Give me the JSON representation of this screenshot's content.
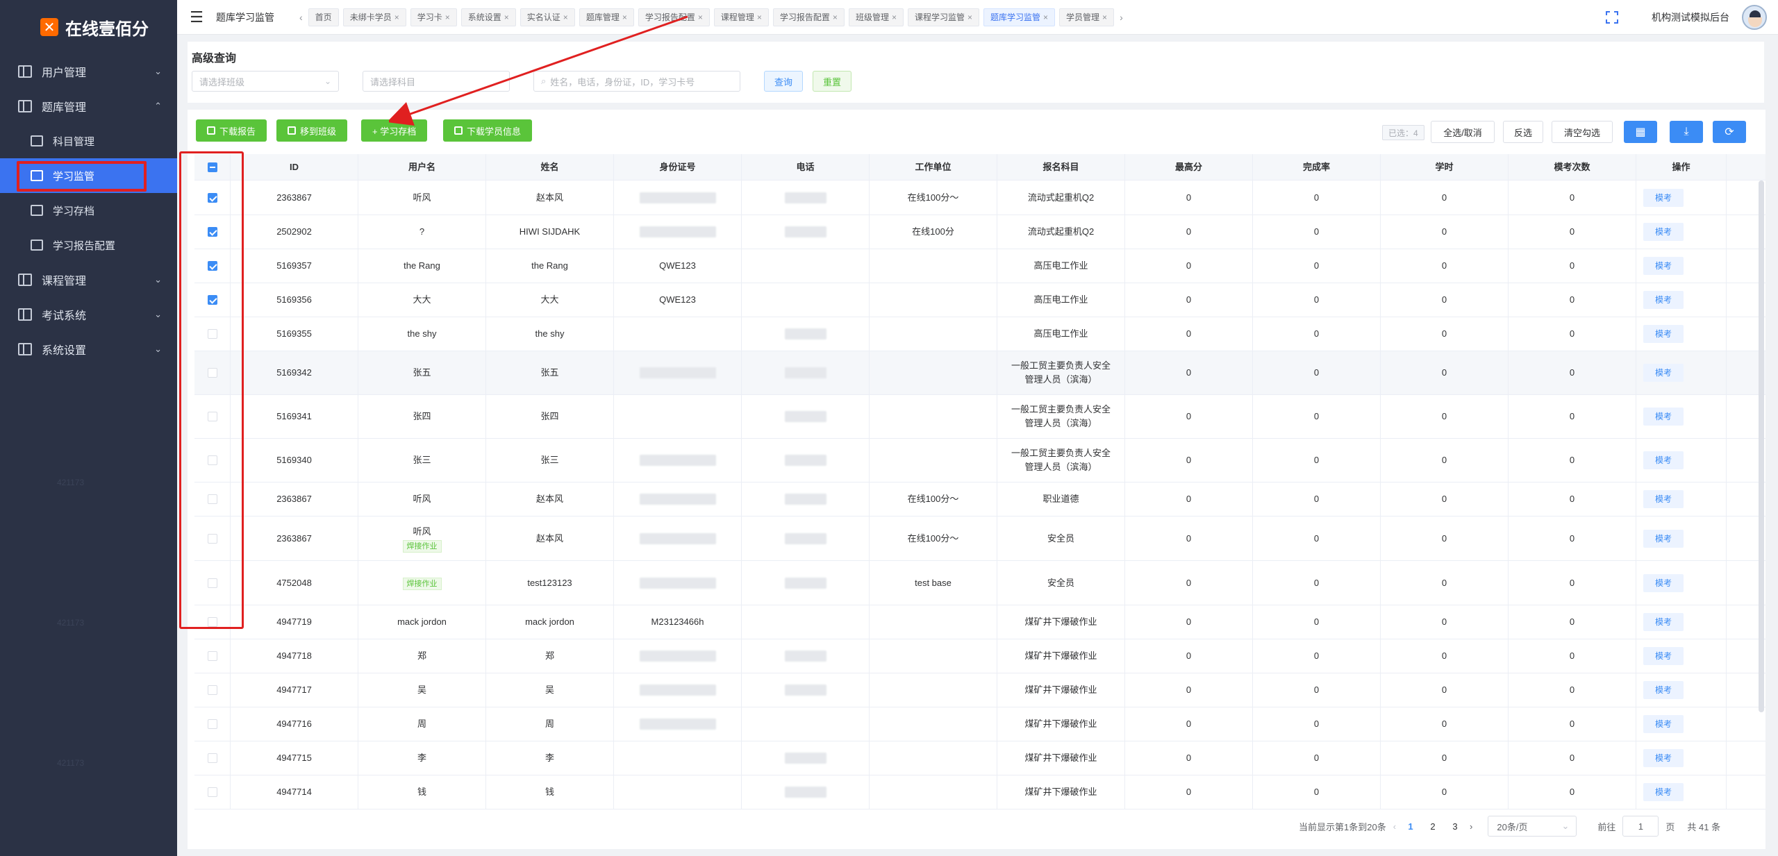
{
  "app": {
    "brand": "在线壹佰分",
    "org_name": "机构测试模拟后台",
    "page_crumb": "题库学习监管"
  },
  "sidebar": {
    "menu": [
      {
        "label": "用户管理",
        "chevron": "⌄"
      },
      {
        "label": "题库管理",
        "chevron": "⌃"
      }
    ],
    "sub": [
      {
        "label": "科目管理"
      },
      {
        "label": "学习监管"
      },
      {
        "label": "学习存档"
      },
      {
        "label": "学习报告配置"
      }
    ],
    "menu2": [
      {
        "label": "课程管理",
        "chevron": "⌄"
      },
      {
        "label": "考试系统",
        "chevron": "⌄"
      },
      {
        "label": "系统设置",
        "chevron": "⌄"
      }
    ],
    "watermarks": [
      "421173",
      "421173",
      "421173"
    ]
  },
  "tabs": [
    {
      "label": "首页",
      "closable": false
    },
    {
      "label": "未绑卡学员",
      "closable": true
    },
    {
      "label": "学习卡",
      "closable": true
    },
    {
      "label": "系统设置",
      "closable": true
    },
    {
      "label": "实名认证",
      "closable": true
    },
    {
      "label": "题库管理",
      "closable": true
    },
    {
      "label": "学习报告配置",
      "closable": true
    },
    {
      "label": "课程管理",
      "closable": true
    },
    {
      "label": "学习报告配置",
      "closable": true
    },
    {
      "label": "班级管理",
      "closable": true
    },
    {
      "label": "课程学习监管",
      "closable": true
    },
    {
      "label": "题库学习监管",
      "closable": true,
      "active": true
    },
    {
      "label": "学员管理",
      "closable": true
    }
  ],
  "search": {
    "title": "高级查询",
    "class_placeholder": "请选择班级",
    "subject_placeholder": "请选择科目",
    "keyword_placeholder": "姓名，电话，身份证，ID，学习卡号",
    "query_label": "查询",
    "reset_label": "重置"
  },
  "toolbar": {
    "download_report": "下载报告",
    "move_class": "移到班级",
    "archive": "+ 学习存档",
    "download_info": "下载学员信息",
    "selected": "已选：4",
    "select_all": "全选/取消",
    "invert": "反选",
    "clear": "清空勾选"
  },
  "table": {
    "headers": [
      "ID",
      "用户名",
      "姓名",
      "身份证号",
      "电话",
      "工作单位",
      "报名科目",
      "最高分",
      "完成率",
      "学时",
      "模考次数",
      "操作"
    ],
    "op_label": "模考",
    "rows": [
      {
        "checked": true,
        "id": "2363867",
        "username": "听风",
        "tag": "",
        "name": "赵本风",
        "idcard": "",
        "idblur": true,
        "phoneblur": true,
        "work": "在线100分～",
        "subject": "流动式起重机Q2",
        "max": "0",
        "rate": "0",
        "hours": "0",
        "mock": "0",
        "h": 50
      },
      {
        "checked": true,
        "id": "2502902",
        "username": "?",
        "tag": "",
        "name": "HIWI SIJDAHK",
        "idcard": "",
        "idblur": true,
        "phoneblur": true,
        "work": "在线100分",
        "subject": "流动式起重机Q2",
        "max": "0",
        "rate": "0",
        "hours": "0",
        "mock": "0",
        "h": 49
      },
      {
        "checked": true,
        "id": "5169357",
        "username": "the Rang",
        "tag": "",
        "name": "the Rang",
        "idcard": "QWE123",
        "idblur": false,
        "phoneblur": false,
        "work": "",
        "subject": "高压电工作业",
        "max": "0",
        "rate": "0",
        "hours": "0",
        "mock": "0",
        "h": 49
      },
      {
        "checked": true,
        "id": "5169356",
        "username": "大大",
        "tag": "",
        "name": "大大",
        "idcard": "QWE123",
        "idblur": false,
        "phoneblur": false,
        "work": "",
        "subject": "高压电工作业",
        "max": "0",
        "rate": "0",
        "hours": "0",
        "mock": "0",
        "h": 49
      },
      {
        "checked": false,
        "id": "5169355",
        "username": "the shy",
        "tag": "",
        "name": "the shy",
        "idcard": "",
        "idblur": false,
        "phoneblur": true,
        "work": "",
        "subject": "高压电工作业",
        "max": "0",
        "rate": "0",
        "hours": "0",
        "mock": "0",
        "h": 49
      },
      {
        "checked": false,
        "id": "5169342",
        "username": "张五",
        "tag": "",
        "name": "张五",
        "idcard": "",
        "idblur": true,
        "phoneblur": true,
        "work": "",
        "subject": "一般工贸主要负责人安全管理人员（滨海）",
        "max": "0",
        "rate": "0",
        "hours": "0",
        "mock": "0",
        "h": 63,
        "hl": true
      },
      {
        "checked": false,
        "id": "5169341",
        "username": "张四",
        "tag": "",
        "name": "张四",
        "idcard": "",
        "idblur": false,
        "phoneblur": true,
        "work": "",
        "subject": "一般工贸主要负责人安全管理人员（滨海）",
        "max": "0",
        "rate": "0",
        "hours": "0",
        "mock": "0",
        "h": 63
      },
      {
        "checked": false,
        "id": "5169340",
        "username": "张三",
        "tag": "",
        "name": "张三",
        "idcard": "",
        "idblur": true,
        "phoneblur": true,
        "work": "",
        "subject": "一般工贸主要负责人安全管理人员（滨海）",
        "max": "0",
        "rate": "0",
        "hours": "0",
        "mock": "0",
        "h": 63
      },
      {
        "checked": false,
        "id": "2363867",
        "username": "听风",
        "tag": "",
        "name": "赵本风",
        "idcard": "",
        "idblur": true,
        "phoneblur": true,
        "work": "在线100分～",
        "subject": "职业道德",
        "max": "0",
        "rate": "0",
        "hours": "0",
        "mock": "0",
        "h": 49
      },
      {
        "checked": false,
        "id": "2363867",
        "username": "听风",
        "tag": "焊接作业",
        "name": "赵本风",
        "idcard": "",
        "idblur": true,
        "phoneblur": true,
        "work": "在线100分～",
        "subject": "安全员",
        "max": "0",
        "rate": "0",
        "hours": "0",
        "mock": "0",
        "h": 64
      },
      {
        "checked": false,
        "id": "4752048",
        "username": "",
        "tag": "焊接作业",
        "name": "test123123",
        "idcard": "",
        "idblur": true,
        "phoneblur": true,
        "work": "test base",
        "subject": "安全员",
        "max": "0",
        "rate": "0",
        "hours": "0",
        "mock": "0",
        "h": 64
      },
      {
        "checked": false,
        "id": "4947719",
        "username": "mack jordon",
        "tag": "",
        "name": "mack jordon",
        "idcard": "M23123466h",
        "idblur": false,
        "phoneblur": false,
        "work": "",
        "subject": "煤矿井下爆破作业",
        "max": "0",
        "rate": "0",
        "hours": "0",
        "mock": "0",
        "h": 49
      },
      {
        "checked": false,
        "id": "4947718",
        "username": "郑",
        "tag": "",
        "name": "郑",
        "idcard": "",
        "idblur": true,
        "phoneblur": true,
        "work": "",
        "subject": "煤矿井下爆破作业",
        "max": "0",
        "rate": "0",
        "hours": "0",
        "mock": "0",
        "h": 49
      },
      {
        "checked": false,
        "id": "4947717",
        "username": "吴",
        "tag": "",
        "name": "吴",
        "idcard": "",
        "idblur": true,
        "phoneblur": true,
        "work": "",
        "subject": "煤矿井下爆破作业",
        "max": "0",
        "rate": "0",
        "hours": "0",
        "mock": "0",
        "h": 49
      },
      {
        "checked": false,
        "id": "4947716",
        "username": "周",
        "tag": "",
        "name": "周",
        "idcard": "",
        "idblur": true,
        "phoneblur": false,
        "work": "",
        "subject": "煤矿井下爆破作业",
        "max": "0",
        "rate": "0",
        "hours": "0",
        "mock": "0",
        "h": 49
      },
      {
        "checked": false,
        "id": "4947715",
        "username": "李",
        "tag": "",
        "name": "李",
        "idcard": "",
        "idblur": false,
        "phoneblur": true,
        "work": "",
        "subject": "煤矿井下爆破作业",
        "max": "0",
        "rate": "0",
        "hours": "0",
        "mock": "0",
        "h": 49
      },
      {
        "checked": false,
        "id": "4947714",
        "username": "钱",
        "tag": "",
        "name": "钱",
        "idcard": "",
        "idblur": false,
        "phoneblur": true,
        "work": "",
        "subject": "煤矿井下爆破作业",
        "max": "0",
        "rate": "0",
        "hours": "0",
        "mock": "0",
        "h": 49
      }
    ]
  },
  "pager": {
    "summary": "当前显示第1条到20条",
    "pages": [
      "1",
      "2",
      "3"
    ],
    "page_size": "20条/页",
    "goto_label": "前往",
    "goto_value": "1",
    "page_unit": "页",
    "total": "共 41 条"
  },
  "colors": {
    "primary": "#3b8cf5",
    "success": "#5ac43a",
    "sidebar": "#2b3245",
    "annotation": "#e02020"
  }
}
